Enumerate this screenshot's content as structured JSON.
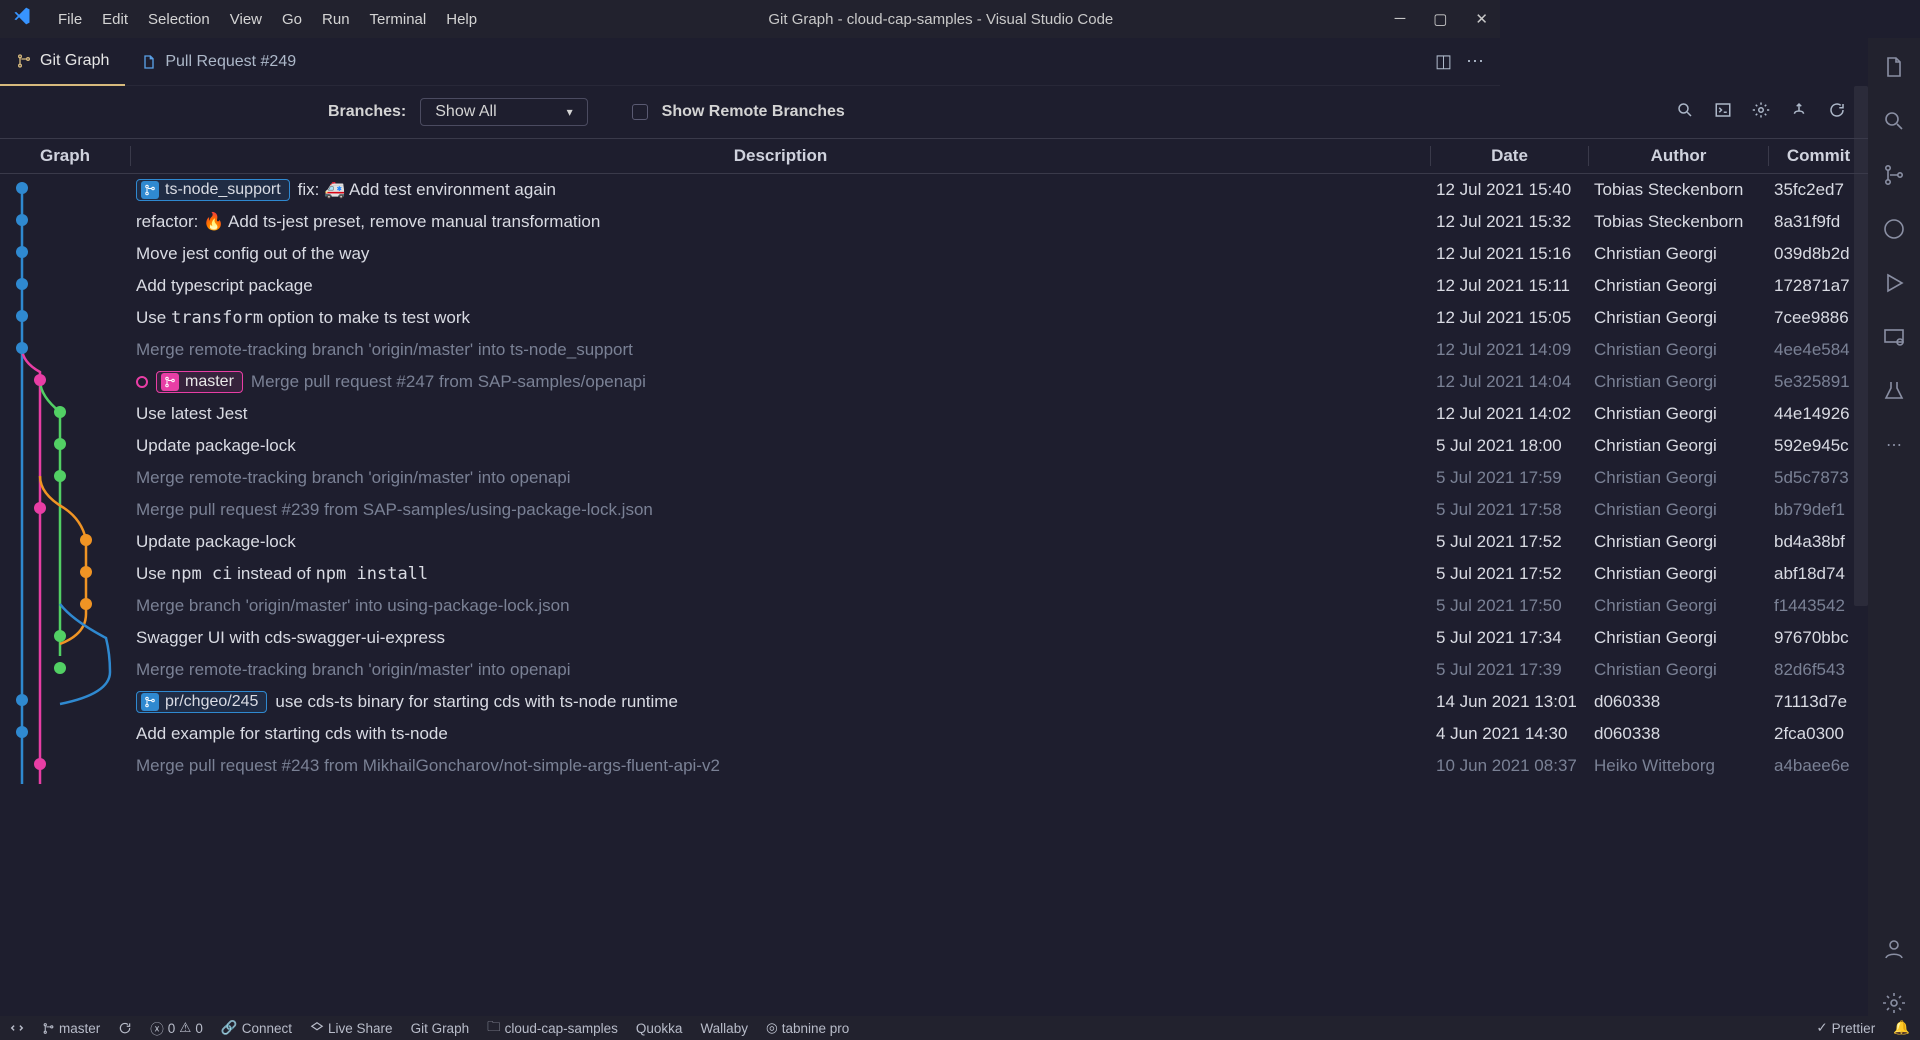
{
  "window": {
    "title": "Git Graph - cloud-cap-samples - Visual Studio Code",
    "menu": [
      "File",
      "Edit",
      "Selection",
      "View",
      "Go",
      "Run",
      "Terminal",
      "Help"
    ]
  },
  "tabs": [
    {
      "label": "Git Graph",
      "icon": "git",
      "active": true
    },
    {
      "label": "Pull Request #249",
      "icon": "file",
      "active": false
    }
  ],
  "toolbar": {
    "branches_label": "Branches:",
    "filter": "Show All",
    "show_remote_label": "Show Remote Branches"
  },
  "columns": {
    "graph": "Graph",
    "desc": "Description",
    "date": "Date",
    "author": "Author",
    "commit": "Commit"
  },
  "commits": [
    {
      "tag": "ts-node_support",
      "tagStyle": "blue",
      "desc": "fix: 🚑 Add test environment again",
      "date": "12 Jul 2021 15:40",
      "author": "Tobias Steckenborn",
      "hash": "35fc2ed7"
    },
    {
      "desc": "refactor: 🔥 Add ts-jest preset, remove manual transformation",
      "date": "12 Jul 2021 15:32",
      "author": "Tobias Steckenborn",
      "hash": "8a31f9fd"
    },
    {
      "desc": "Move jest config out of the way",
      "date": "12 Jul 2021 15:16",
      "author": "Christian Georgi",
      "hash": "039d8b2d"
    },
    {
      "desc": "Add typescript package",
      "date": "12 Jul 2021 15:11",
      "author": "Christian Georgi",
      "hash": "172871a7"
    },
    {
      "html": "Use <code>transform</code> option to make ts test work",
      "date": "12 Jul 2021 15:05",
      "author": "Christian Georgi",
      "hash": "7cee9886"
    },
    {
      "desc": "Merge remote-tracking branch 'origin/master' into ts-node_support",
      "date": "12 Jul 2021 14:09",
      "author": "Christian Georgi",
      "hash": "4ee4e584",
      "muted": true
    },
    {
      "head": true,
      "tag": "master",
      "tagStyle": "pink",
      "desc": "Merge pull request #247 from SAP-samples/openapi",
      "date": "12 Jul 2021 14:04",
      "author": "Christian Georgi",
      "hash": "5e325891",
      "muted": true
    },
    {
      "desc": "Use latest Jest",
      "date": "12 Jul 2021 14:02",
      "author": "Christian Georgi",
      "hash": "44e14926"
    },
    {
      "desc": "Update package-lock",
      "date": "5 Jul 2021 18:00",
      "author": "Christian Georgi",
      "hash": "592e945c"
    },
    {
      "desc": "Merge remote-tracking branch 'origin/master' into openapi",
      "date": "5 Jul 2021 17:59",
      "author": "Christian Georgi",
      "hash": "5d5c7873",
      "muted": true
    },
    {
      "desc": "Merge pull request #239 from SAP-samples/using-package-lock.json",
      "date": "5 Jul 2021 17:58",
      "author": "Christian Georgi",
      "hash": "bb79def1",
      "muted": true
    },
    {
      "desc": "Update package-lock",
      "date": "5 Jul 2021 17:52",
      "author": "Christian Georgi",
      "hash": "bd4a38bf"
    },
    {
      "html": "Use <code>npm ci</code> instead of <code>npm install</code>",
      "date": "5 Jul 2021 17:52",
      "author": "Christian Georgi",
      "hash": "abf18d74"
    },
    {
      "desc": "Merge branch 'origin/master' into using-package-lock.json",
      "date": "5 Jul 2021 17:50",
      "author": "Christian Georgi",
      "hash": "f1443542",
      "muted": true
    },
    {
      "desc": "Swagger UI with cds-swagger-ui-express",
      "date": "5 Jul 2021 17:34",
      "author": "Christian Georgi",
      "hash": "97670bbc"
    },
    {
      "desc": "Merge remote-tracking branch 'origin/master' into openapi",
      "date": "5 Jul 2021 17:39",
      "author": "Christian Georgi",
      "hash": "82d6f543",
      "muted": true
    },
    {
      "tag": "pr/chgeo/245",
      "tagStyle": "blue",
      "desc": "use cds-ts binary for starting cds with ts-node runtime",
      "date": "14 Jun 2021 13:01",
      "author": "d060338",
      "hash": "71113d7e"
    },
    {
      "desc": "Add example for starting cds with ts-node",
      "date": "4 Jun 2021 14:30",
      "author": "d060338",
      "hash": "2fca0300"
    },
    {
      "desc": "Merge pull request #243 from MikhailGoncharov/not-simple-args-fluent-api-v2",
      "date": "10 Jun 2021 08:37",
      "author": "Heiko Witteborg",
      "hash": "a4baee6e",
      "muted": true
    }
  ],
  "statusbar": {
    "branch": "master",
    "errors": "0",
    "warnings": "0",
    "connect": "Connect",
    "liveshare": "Live Share",
    "gitgraph": "Git Graph",
    "project": "cloud-cap-samples",
    "quokka": "Quokka",
    "wallaby": "Wallaby",
    "tabnine": "tabnine pro",
    "prettier": "Prettier"
  }
}
